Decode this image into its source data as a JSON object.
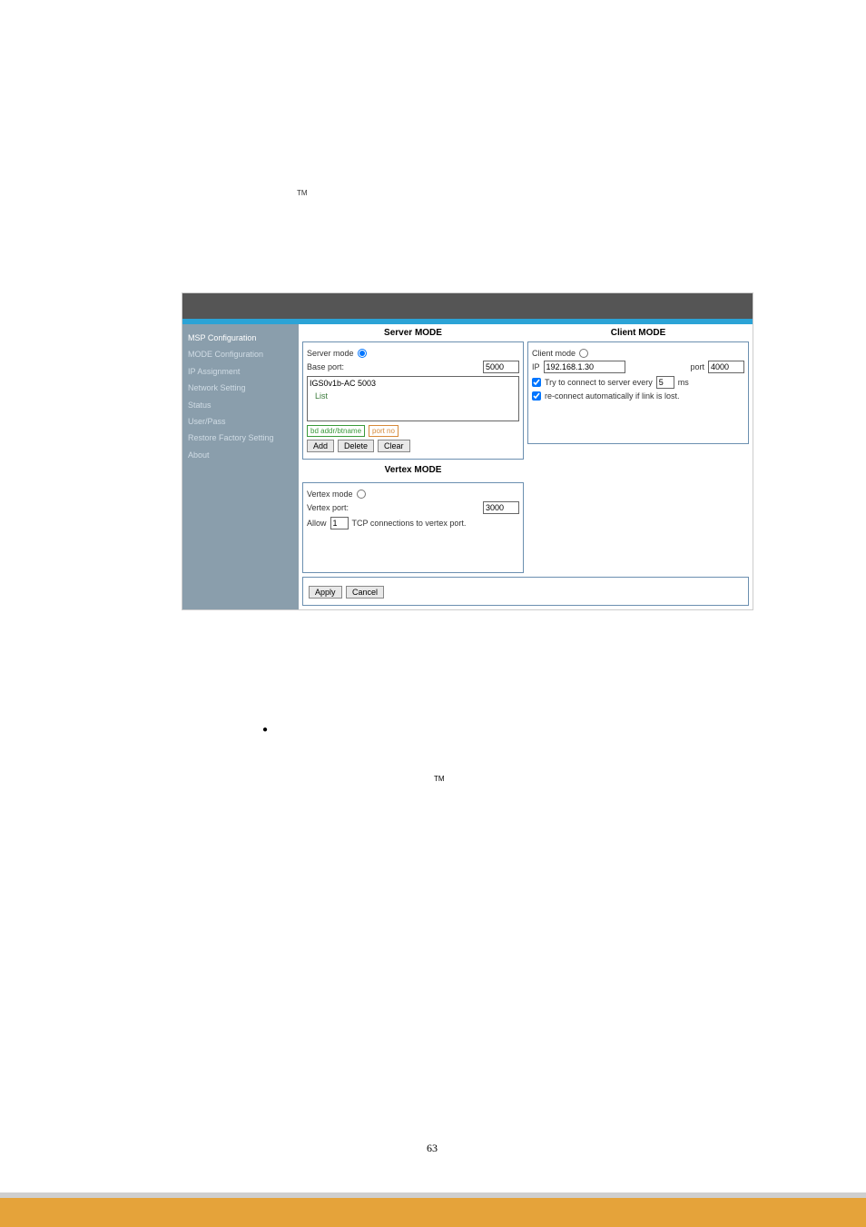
{
  "tm": "TM",
  "sidebar": {
    "items": [
      {
        "label": "MSP Configuration"
      },
      {
        "label": "MODE Configuration"
      },
      {
        "label": "IP Assignment"
      },
      {
        "label": "Network Setting"
      },
      {
        "label": "Status"
      },
      {
        "label": "User/Pass"
      },
      {
        "label": "Restore Factory Setting"
      },
      {
        "label": "About"
      }
    ]
  },
  "server_mode": {
    "title": "Server MODE",
    "radio_label": "Server mode",
    "base_port_label": "Base port:",
    "base_port_value": "5000",
    "list_entry": "IGS0v1b-AC 5003",
    "list_label": "List",
    "bdaddr_placeholder": "bd addr/btname",
    "port_placeholder": "port no",
    "add_btn": "Add",
    "delete_btn": "Delete",
    "clear_btn": "Clear"
  },
  "client_mode": {
    "title": "Client MODE",
    "radio_label": "Client mode",
    "ip_label": "IP",
    "ip_value": "192.168.1.30",
    "port_label": "port",
    "port_value": "4000",
    "try_connect_label": "Try to connect to server every",
    "try_connect_value": "5",
    "try_connect_unit": "ms",
    "reconnect_label": "re-connect automatically if link is lost."
  },
  "vertex_mode": {
    "title": "Vertex MODE",
    "radio_label": "Vertex mode",
    "port_label": "Vertex port:",
    "port_value": "3000",
    "allow_label": "Allow",
    "allow_value": "1",
    "allow_suffix": "TCP connections to vertex port."
  },
  "actions": {
    "apply": "Apply",
    "cancel": "Cancel"
  },
  "page_number": "63",
  "bullet": "●"
}
